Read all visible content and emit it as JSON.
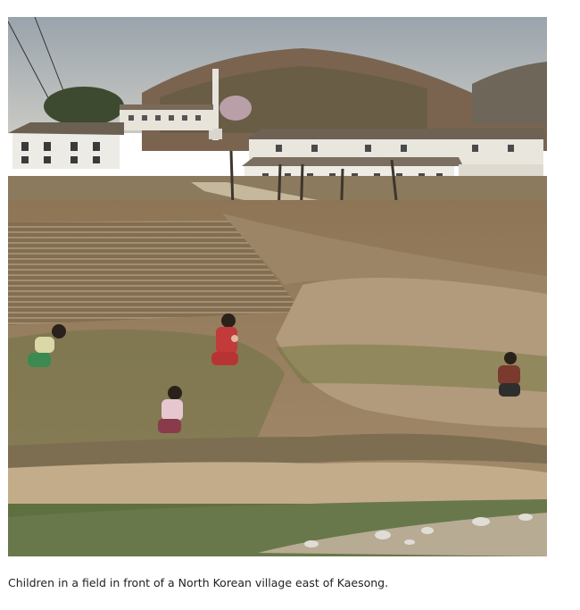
{
  "photo": {
    "alt": "Children in a field in front of a North Korean village east of Kaesong."
  },
  "caption": "Children in a field in front of a North Korean village east of Kaesong."
}
